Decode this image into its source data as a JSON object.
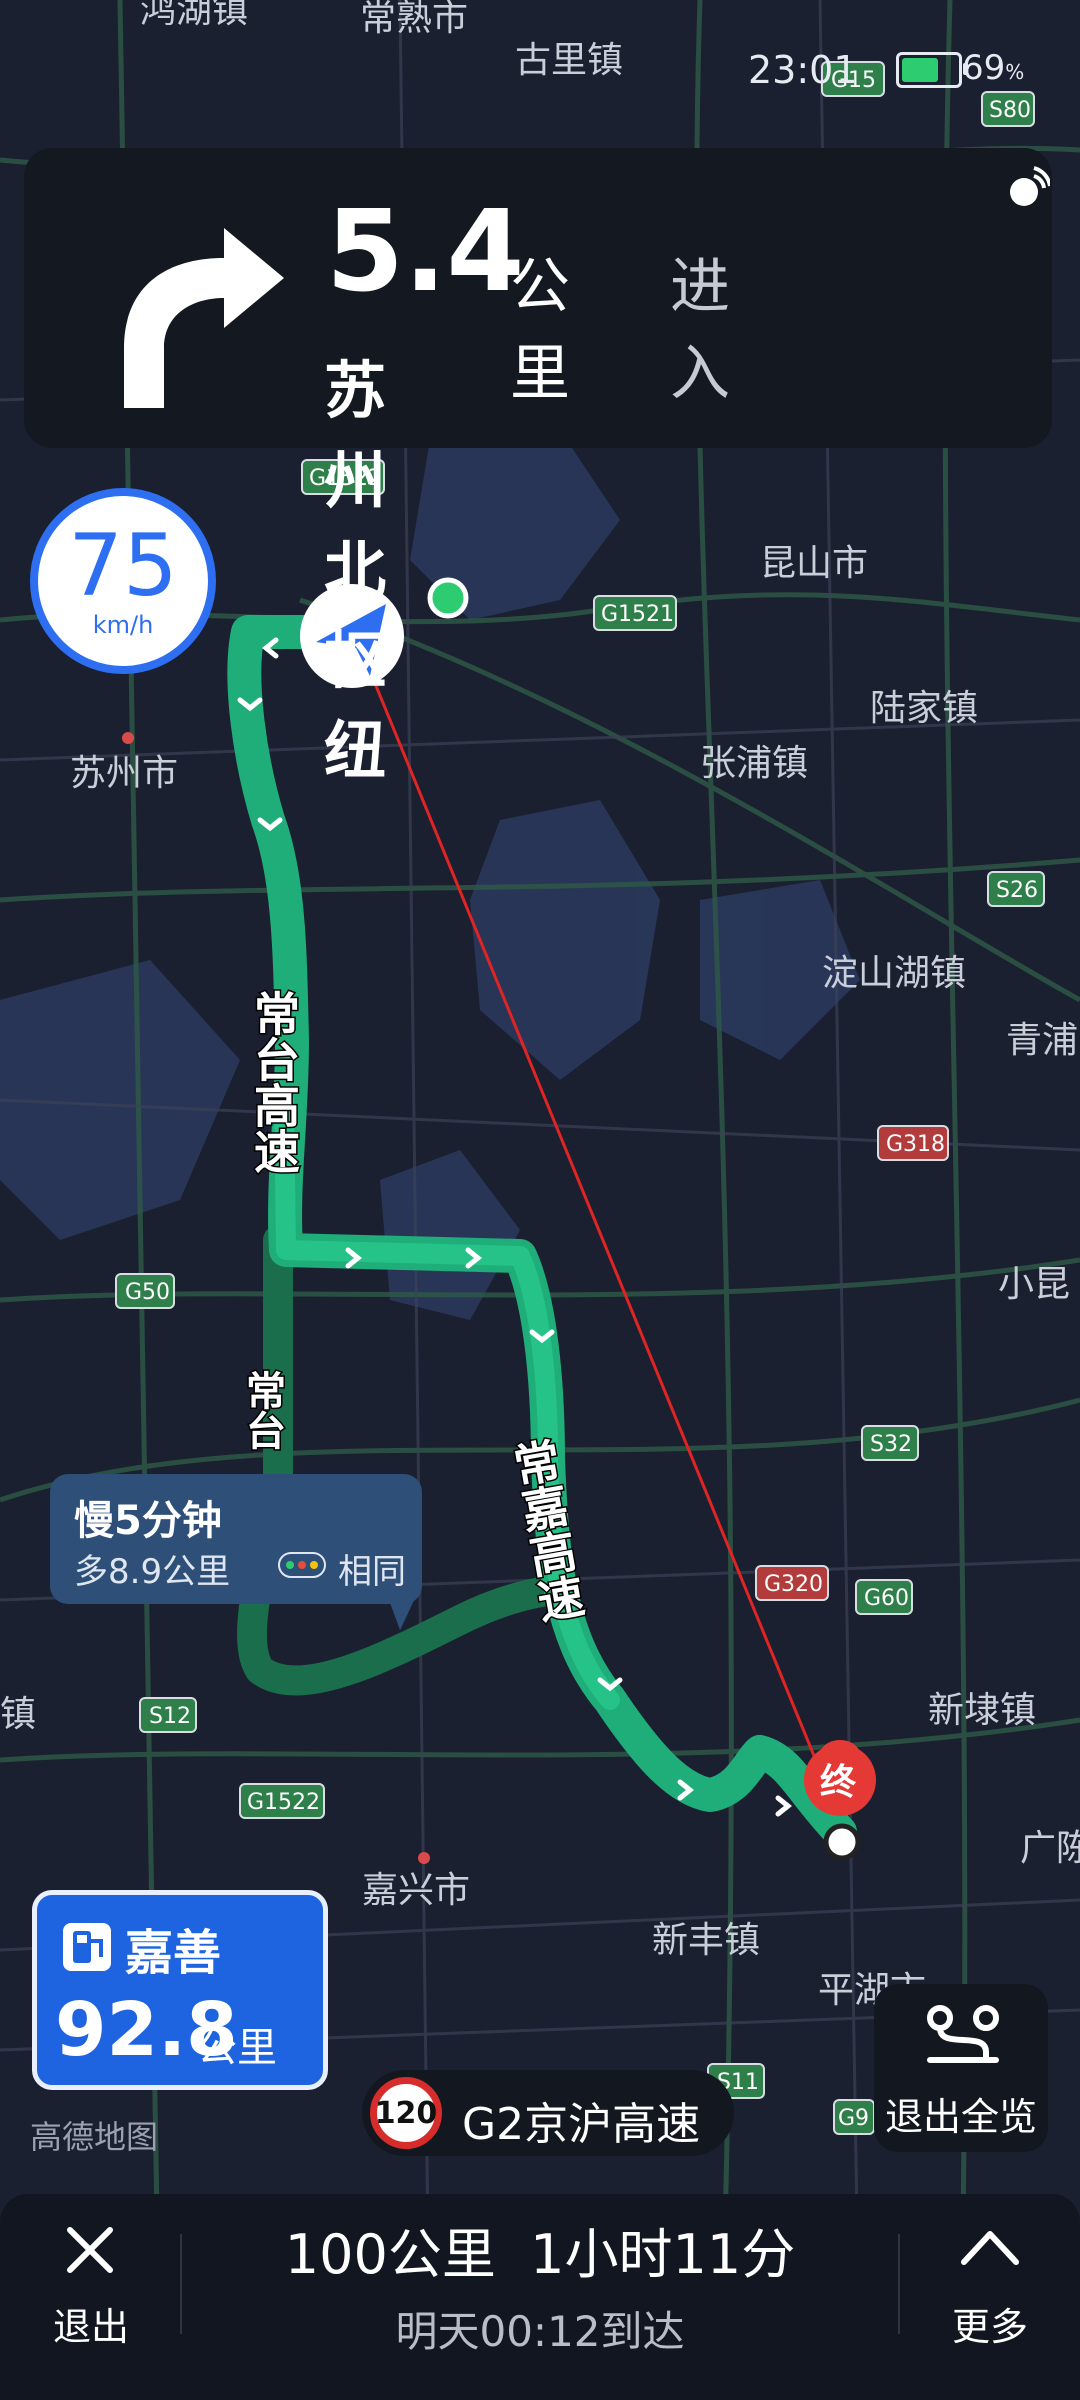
{
  "status_bar": {
    "time": "23:01",
    "battery_pct": "69",
    "battery_sign": "%"
  },
  "navigation": {
    "distance_value": "5.4",
    "distance_unit": "公里",
    "action": "进入",
    "road_name": "苏州北枢纽",
    "turn": "right-turn-arrow",
    "voice": "speaker-icon"
  },
  "speed": {
    "value": "75",
    "unit": "km/h"
  },
  "route_labels": {
    "primary_road": "常台高速",
    "secondary_road": "常嘉高速",
    "alt_road": "常台"
  },
  "alt_route": {
    "title": "慢5分钟",
    "detail": "多8.9公里",
    "traffic": "相同",
    "traffic_colors": [
      "#2ecc71",
      "#e74c3c",
      "#f1c40f"
    ]
  },
  "service_area": {
    "name": "嘉善",
    "distance": "92.8",
    "unit": "公里"
  },
  "map_watermark": "高德地图",
  "speed_limit": {
    "value": "120",
    "road": "G2京沪高速"
  },
  "overview": {
    "label": "退出全览"
  },
  "destination_marker": "终",
  "map_labels": {
    "town1": "古里镇",
    "town2": "常熟市",
    "town3": "鸿湖镇",
    "city_suzhou": "苏州市",
    "city_kunshan": "昆山市",
    "town_lujia": "陆家镇",
    "town_zhangpu": "张浦镇",
    "town_dianshanhu": "淀山湖镇",
    "town_qingpu": "青浦",
    "town_xiaokun": "小昆",
    "town_xindai": "新埭镇",
    "city_jiaxing": "嘉兴市",
    "town_xinfeng": "新丰镇",
    "town_pinghu": "平湖市",
    "town_guang": "广陈",
    "town_luo": "镇"
  },
  "road_shields": [
    "G15",
    "S80",
    "G1522",
    "G1521",
    "S26",
    "G318",
    "G50",
    "S32",
    "G320",
    "G60",
    "S12",
    "G1522",
    "S11",
    "G9"
  ],
  "bottom_bar": {
    "exit_label": "退出",
    "trip_distance": "100公里",
    "trip_time": "1小时11分",
    "arrival": "明天00:12到达",
    "more_label": "更多"
  },
  "colors": {
    "route": "#1fae7a",
    "route_bright": "#2ad08f",
    "accent_blue": "#2e6ff2",
    "destination": "#e53935"
  }
}
